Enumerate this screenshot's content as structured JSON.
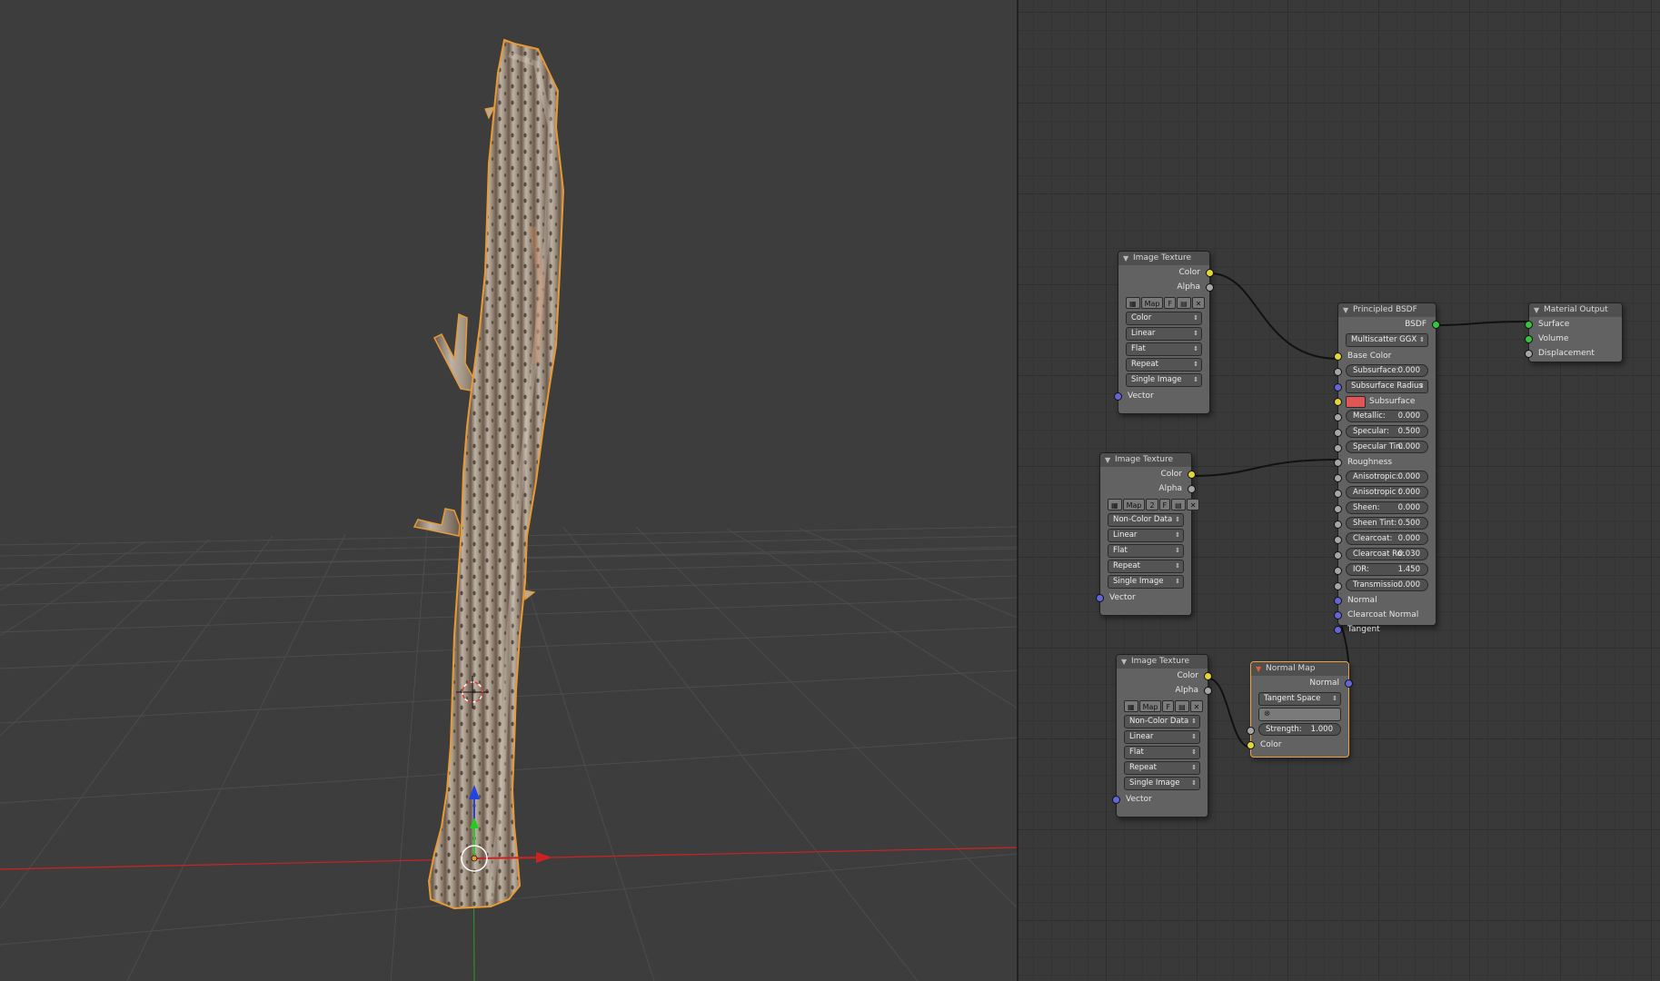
{
  "nodes": {
    "image_texture_1": {
      "title": "Image Texture",
      "outputs": [
        "Color",
        "Alpha"
      ],
      "toolbar": [
        "Map",
        "F"
      ],
      "settings": [
        "Color",
        "Linear",
        "Flat",
        "Repeat",
        "Single Image"
      ],
      "input": "Vector"
    },
    "image_texture_2": {
      "title": "Image Texture",
      "outputs": [
        "Color",
        "Alpha"
      ],
      "toolbar": [
        "Map",
        "2",
        "F"
      ],
      "settings": [
        "Non-Color Data",
        "Linear",
        "Flat",
        "Repeat",
        "Single Image"
      ],
      "input": "Vector"
    },
    "image_texture_3": {
      "title": "Image Texture",
      "outputs": [
        "Color",
        "Alpha"
      ],
      "toolbar": [
        "Map",
        "F"
      ],
      "settings": [
        "Non-Color Data",
        "Linear",
        "Flat",
        "Repeat",
        "Single Image"
      ],
      "input": "Vector"
    },
    "principled_bsdf": {
      "title": "Principled BSDF",
      "output": "BSDF",
      "distribution": "Multiscatter GGX",
      "base_color": "Base Color",
      "subsurface": {
        "label": "Subsurface:",
        "value": "0.000"
      },
      "subsurface_radius": "Subsurface Radius",
      "subsurface_color": "Subsurface Colo",
      "subsurface_color_hex": "#e05555",
      "metallic": {
        "label": "Metallic:",
        "value": "0.000"
      },
      "specular": {
        "label": "Specular:",
        "value": "0.500"
      },
      "specular_tint": {
        "label": "Specular Tin:",
        "value": "0.000"
      },
      "roughness": "Roughness",
      "anisotropic": {
        "label": "Anisotropic:",
        "value": "0.000"
      },
      "anisotropic_rotation": {
        "label": "Anisotropic :",
        "value": "0.000"
      },
      "sheen": {
        "label": "Sheen:",
        "value": "0.000"
      },
      "sheen_tint": {
        "label": "Sheen Tint:",
        "value": "0.500"
      },
      "clearcoat": {
        "label": "Clearcoat:",
        "value": "0.000"
      },
      "clearcoat_roughness": {
        "label": "Clearcoat Ro:",
        "value": "0.030"
      },
      "ior": {
        "label": "IOR:",
        "value": "1.450"
      },
      "transmission": {
        "label": "Transmissio:",
        "value": "0.000"
      },
      "normal": "Normal",
      "clearcoat_normal": "Clearcoat Normal",
      "tangent": "Tangent"
    },
    "material_output": {
      "title": "Material Output",
      "inputs": [
        "Surface",
        "Volume",
        "Displacement"
      ]
    },
    "normal_map": {
      "title": "Normal Map",
      "output": "Normal",
      "space": "Tangent Space",
      "strength": {
        "label": "Strength:",
        "value": "1.000"
      },
      "input": "Color"
    }
  },
  "colors": {
    "socket_color": "#e3d53a",
    "socket_float": "#a6a6a6",
    "socket_vector": "#6466d8",
    "socket_shader": "#37c23f",
    "active_outline": "#e8a343",
    "axis_x": "#cc2222",
    "axis_y": "#22cc22",
    "axis_z": "#2244dd"
  }
}
